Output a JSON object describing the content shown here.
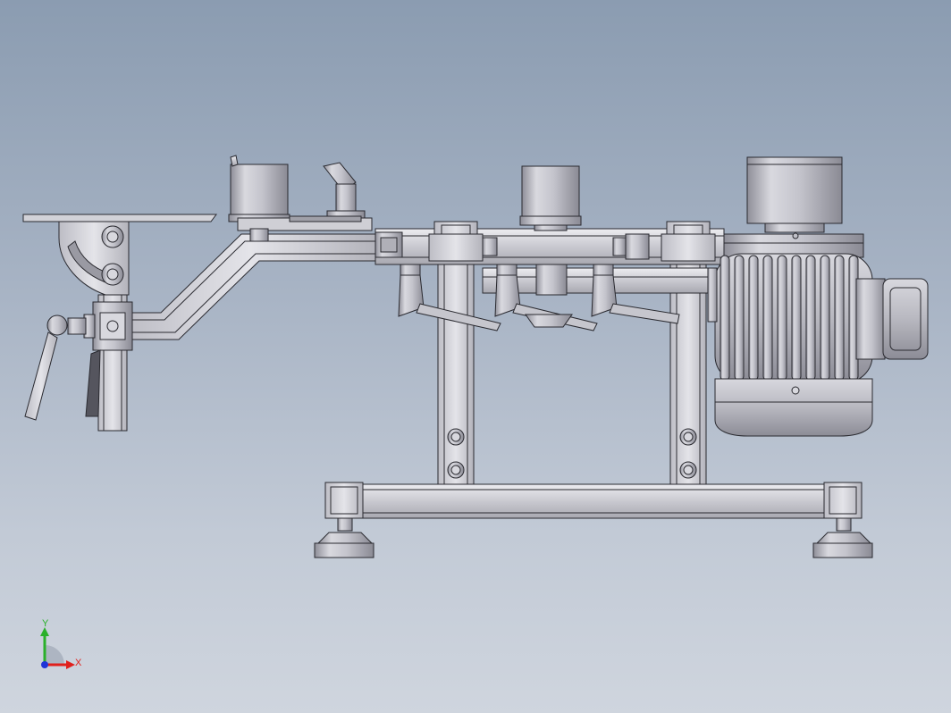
{
  "viewport": {
    "background_top": "#8b9cb1",
    "background_bottom": "#cfd5de"
  },
  "triad": {
    "x_label": "X",
    "y_label": "Y",
    "x_color": "#e0201c",
    "y_color": "#2ab02a",
    "z_color": "#2035d8"
  },
  "model": {
    "steel_light": "#e6e6ea",
    "steel_mid": "#c8c8cf",
    "steel_dark": "#9a9aa3",
    "edge": "#2a2a30"
  }
}
